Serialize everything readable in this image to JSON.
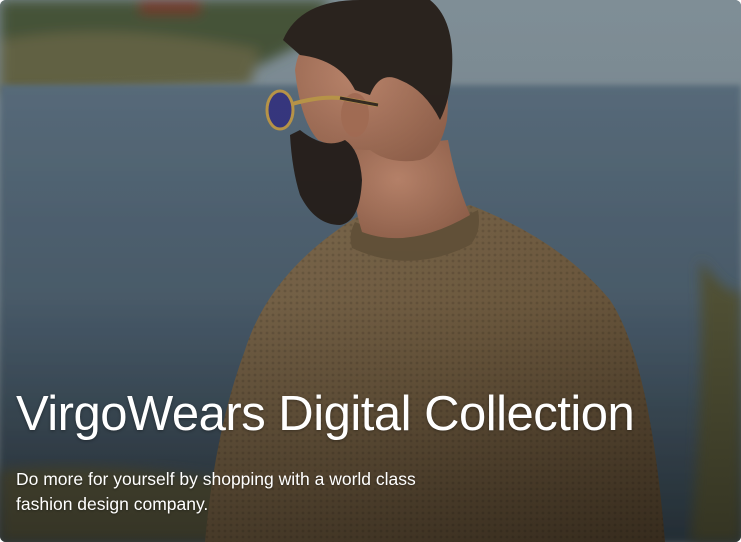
{
  "hero": {
    "title": "VirgoWears Digital Collection",
    "subtitle": "Do more for yourself by shopping with a world class fashion design company.",
    "text_color": "#ffffff",
    "photo_icon": "man-in-knit-sweater-photo"
  }
}
